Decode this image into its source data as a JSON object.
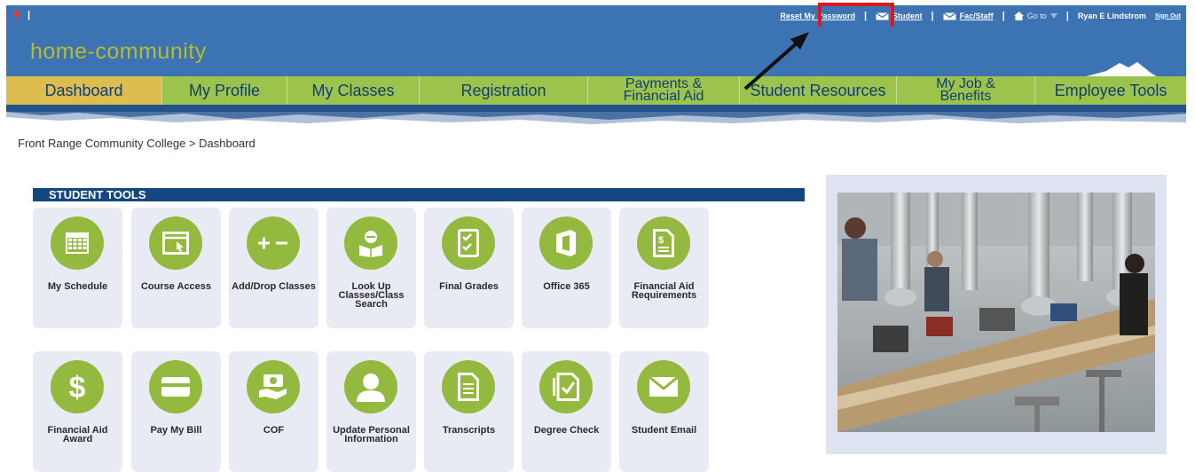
{
  "topbar": {
    "reset_password": "Reset My Password",
    "student_link": "Student",
    "facstaff_link": "Fac/Staff",
    "goto_label": "Go to",
    "user_name": "Ryan E Lindstrom",
    "sign_out": "Sign Out",
    "separator": "|"
  },
  "banner": {
    "site_name": "home-community"
  },
  "nav": {
    "dashboard": "Dashboard",
    "my_profile": "My Profile",
    "my_classes": "My Classes",
    "registration": "Registration",
    "payments_line1": "Payments &",
    "payments_line2": "Financial Aid",
    "student_resources": "Student Resources",
    "myjob_line1": "My Job &",
    "myjob_line2": "Benefits",
    "employee_tools": "Employee Tools"
  },
  "breadcrumb": "Front Range Community College > Dashboard",
  "student_tools": {
    "header": "STUDENT TOOLS",
    "tiles": [
      {
        "label": "My Schedule",
        "icon": "calendar-icon"
      },
      {
        "label": "Course Access",
        "icon": "browser-window-icon"
      },
      {
        "label": "Add/Drop Classes",
        "icon": "plus-minus-icon"
      },
      {
        "label": "Look Up Classes/Class Search",
        "icon": "student-reading-icon"
      },
      {
        "label": "Final Grades",
        "icon": "checklist-icon"
      },
      {
        "label": "Office 365",
        "icon": "office-365-icon"
      },
      {
        "label": "Financial Aid Requirements",
        "icon": "dollar-document-icon"
      },
      {
        "label": "Financial Aid Award",
        "icon": "dollar-icon"
      },
      {
        "label": "Pay My Bill",
        "icon": "credit-card-icon"
      },
      {
        "label": "COF",
        "icon": "money-hand-icon"
      },
      {
        "label": "Update Personal Information",
        "icon": "person-icon"
      },
      {
        "label": "Transcripts",
        "icon": "document-icon"
      },
      {
        "label": "Degree Check",
        "icon": "document-check-icon"
      },
      {
        "label": "Student Email",
        "icon": "envelope-icon"
      }
    ]
  },
  "colors": {
    "header_blue": "#3c73b2",
    "nav_green": "#9cc44c",
    "nav_active": "#dcbd4d",
    "tile_icon_green": "#93b93f",
    "tools_bar": "#14477f",
    "highlight_red": "#e0161f"
  }
}
